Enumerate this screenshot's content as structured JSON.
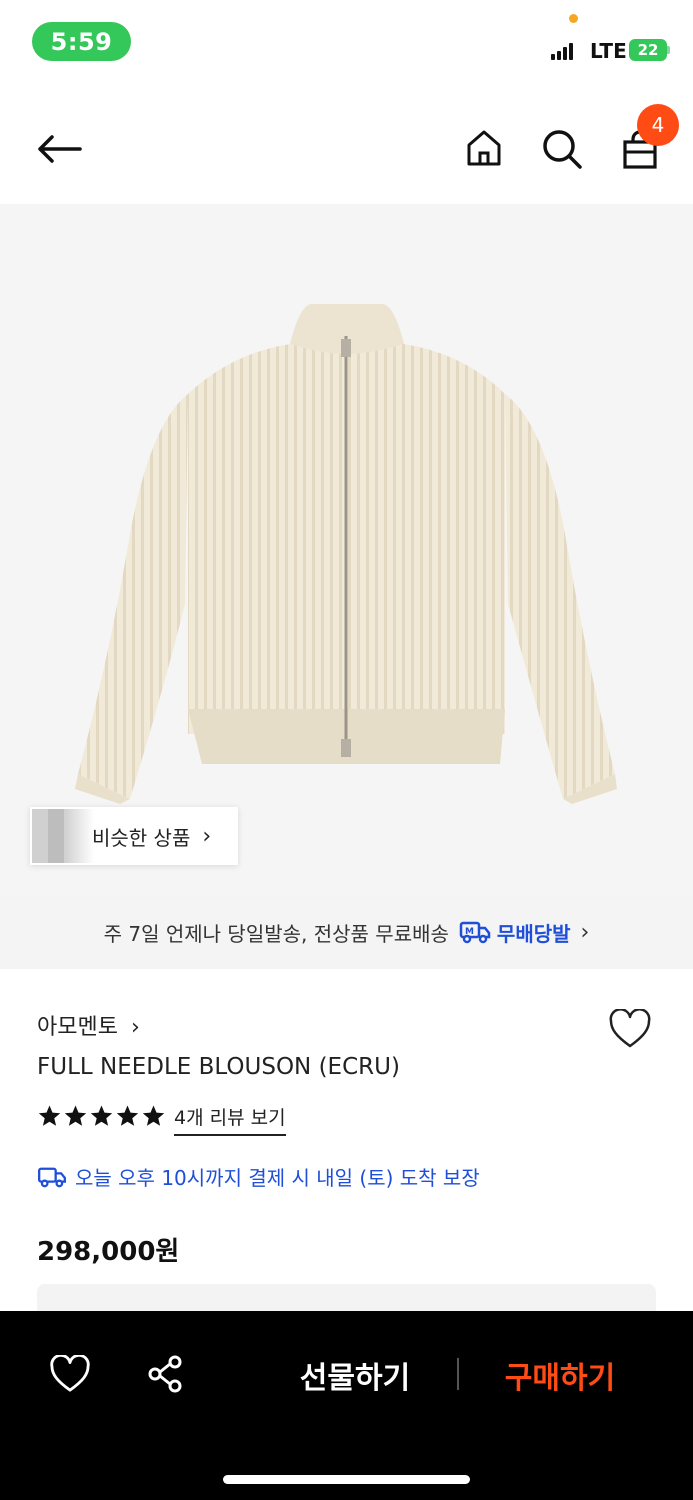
{
  "status_bar": {
    "time": "5:59",
    "network": "LTE",
    "battery": "22"
  },
  "nav": {
    "cart_count": "4"
  },
  "similar": {
    "label": "비슷한 상품"
  },
  "banner": {
    "text": "주 7일 언제나 당일발송, 전상품 무료배송",
    "brand": "무배당발"
  },
  "product": {
    "brand": "아모멘토",
    "title": "FULL NEEDLE BLOUSON (ECRU)",
    "rating_stars": 5,
    "reviews_link": "4개 리뷰 보기",
    "arrival_text": "오늘 오후 10시까지 결제 시 내일 (토) 도착 보장",
    "price": "298,000원"
  },
  "bottom": {
    "gift_label": "선물하기",
    "buy_label": "구매하기"
  },
  "colors": {
    "accent": "#ff4b14",
    "link_blue": "#1f4fd8",
    "status_green": "#34c759"
  }
}
